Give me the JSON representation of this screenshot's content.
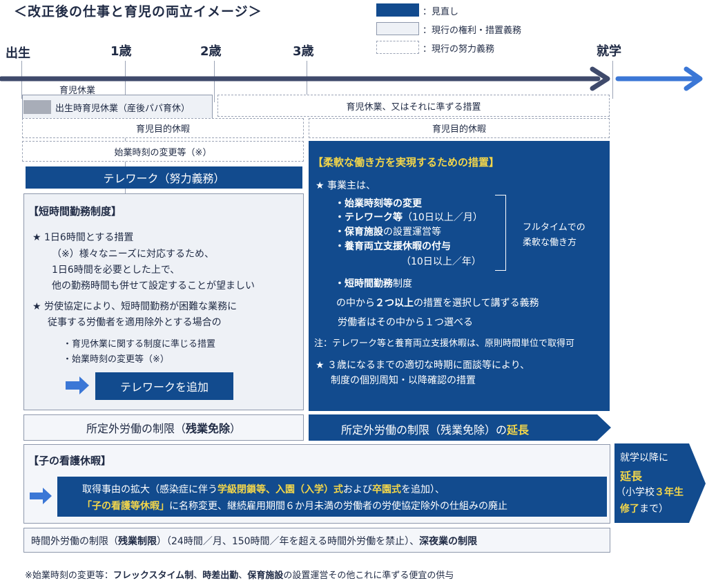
{
  "title": "＜改正後の仕事と育児の両立イメージ＞",
  "legend": [
    {
      "style": "solid-blue",
      "label": "：見直し"
    },
    {
      "style": "solid-light",
      "label": "：現行の権利・措置義務"
    },
    {
      "style": "dashed",
      "label": "：現行の努力義務"
    }
  ],
  "timeline": {
    "start": "出生",
    "one": "1歳",
    "two": "2歳",
    "three": "3歳",
    "school": "就学"
  },
  "childcare_leave": {
    "label": "育児休業",
    "paternity": "出生時育児休業（産後パパ育休）",
    "after": "育児休業、又はそれに準ずる措置"
  },
  "purpose_leave_left": "育児目的休暇",
  "purpose_leave_right": "育児目的休暇",
  "start_time_change": "始業時刻の変更等（※）",
  "telework": "テレワーク（努力義務）",
  "short_time": {
    "heading": "【短時間勤務制度】",
    "star1": "1日6時間とする措置",
    "note1": "（※）様々なニーズに対応するため、",
    "note2": "1日6時間を必要とした上で、",
    "note3": "他の勤務時間も併せて設定することが望ましい",
    "star2a": "労使協定により、短時間勤務が困難な業務に",
    "star2b": "従事する労働者を適用除外とする場合の",
    "bullet1": "・育児休業に関する制度に準じる措置",
    "bullet2": "・始業時刻の変更等（※）",
    "add_button": "テレワークを追加"
  },
  "flexible": {
    "heading": "【柔軟な働き方を実現するための措置】",
    "employer": "事業主は、",
    "items": [
      {
        "bold": "・始業時刻等の変更",
        "rest": ""
      },
      {
        "bold": "・テレワーク等",
        "rest": "（10日以上／月）"
      },
      {
        "bold": "・保育施設",
        "rest": "の設置運営等"
      },
      {
        "bold": "・養育両立支援休暇の付与",
        "rest": ""
      }
    ],
    "item4_sub": "（10日以上／年）",
    "fulltime1": "フルタイムでの",
    "fulltime2": "柔軟な働き方",
    "short_bold": "・短時間勤務",
    "short_rest": "制度",
    "choose_pre": "の中から",
    "choose_bold": "２つ以上",
    "choose_post": "の措置を選択して講ずる義務",
    "worker": "労働者はその中から１つ選べる",
    "note": "注：テレワーク等と養育両立支援休暇は、原則時間単位で取得可",
    "star3a": "３歳になるまでの適切な時期に面談等により、",
    "star3b": "制度の個別周知・以降確認の措置"
  },
  "overtime_left_pre": "所定外労働の制限（",
  "overtime_left_bold": "残業免除",
  "overtime_left_post": "）",
  "overtime_right_pre": "所定外労働の制限（残業免除）の",
  "overtime_right_yel": "延長",
  "nursing": {
    "heading": "【子の看護休暇】",
    "line1_a": "取得事由の拡大（感染症に伴う",
    "line1_b": "学級閉鎖等、入園（入学）式",
    "line1_c": "および",
    "line1_d": "卒園式",
    "line1_e": "を追加）、",
    "line2_a": "「子の看護等休暇」",
    "line2_b": "に名称変更、継続雇用期間６か月未満の労働者の労使協定除外の仕組みの廃止"
  },
  "school_ext": {
    "line1": "就学以降に",
    "line2": "延長",
    "line3a": "（小学校",
    "line3b": "３年生",
    "line4a": "修了",
    "line4b": "まで）"
  },
  "overtime_limit": {
    "a": "時間外労働の制限（",
    "b": "残業制限",
    "c": "）（24時間／月、150時間／年を超える時間外労働を禁止）、",
    "d": "深夜業の制限"
  },
  "footnote": {
    "a": "※始業時刻の変更等：",
    "b": "フレックスタイム制",
    "c": "、",
    "d": "時差出勤",
    "e": "、",
    "f": "保育施設",
    "g": "の設置運営その他これに準ずる便宜の供与"
  },
  "colors": {
    "accent": "#124b8e",
    "highlight": "#f3d64a",
    "arrow": "#3b77d6",
    "axis": "#3f4a6b"
  }
}
